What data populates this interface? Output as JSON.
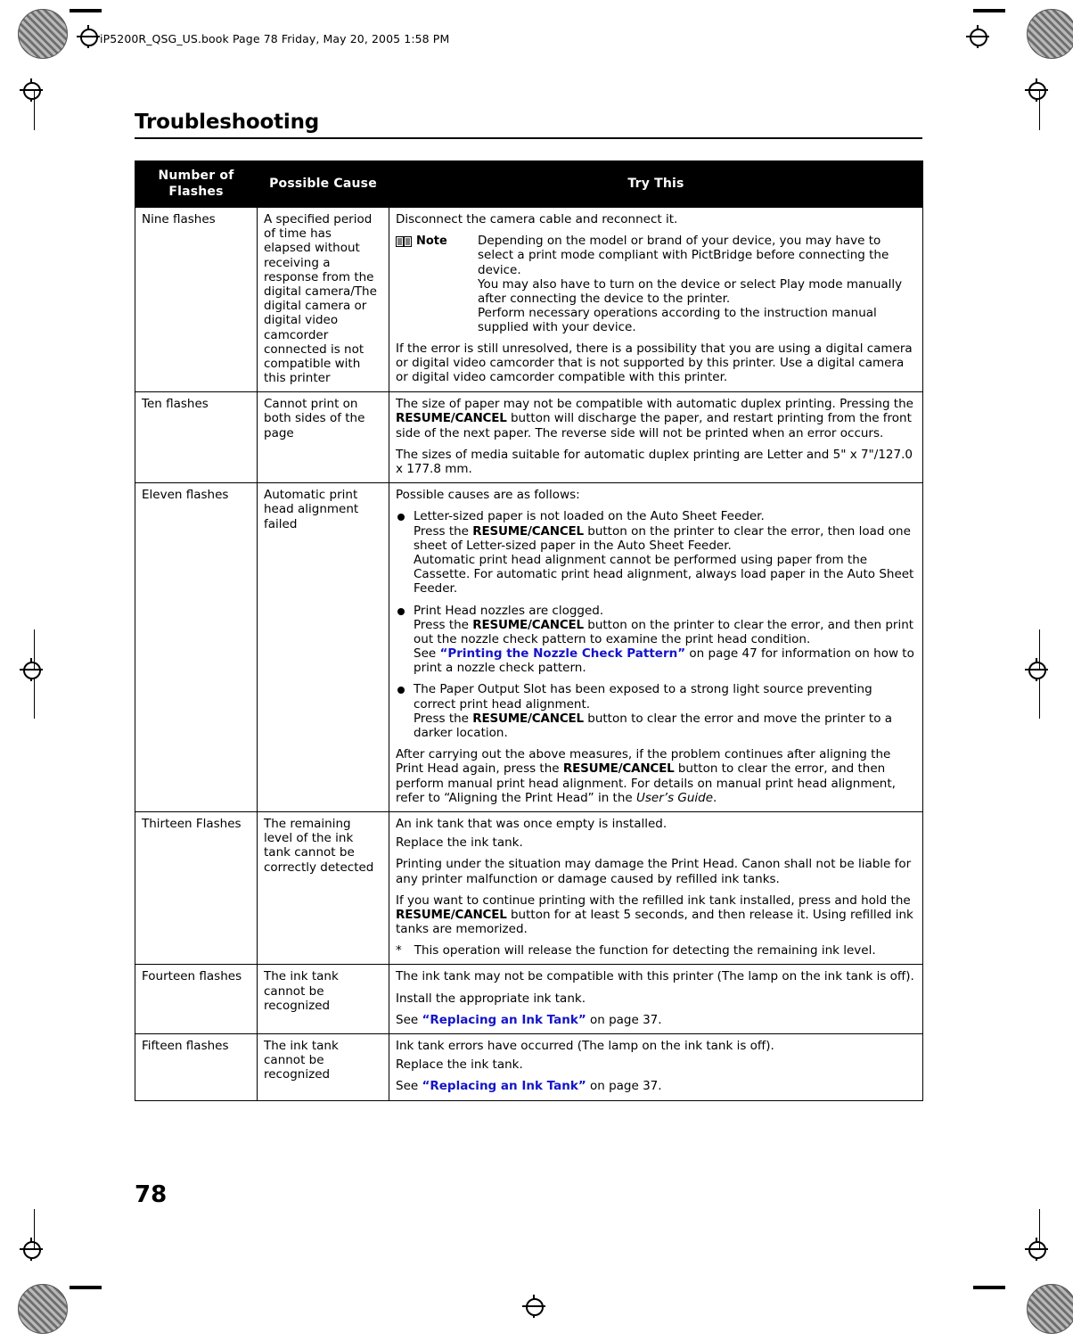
{
  "header": {
    "filestamp": "iP5200R_QSG_US.book  Page 78  Friday, May 20, 2005  1:58 PM",
    "section_title": "Troubleshooting",
    "page_number": "78"
  },
  "icons": {
    "note": "note-book-icon",
    "registration": "registration-mark-icon",
    "crosshair": "crosshair-registration-icon"
  },
  "colors": {
    "link": "#1414c8",
    "header_bg": "#000000",
    "header_fg": "#ffffff"
  },
  "table": {
    "columns": [
      "Number of Flashes",
      "Possible Cause",
      "Try This"
    ],
    "rows": [
      {
        "flashes": "Nine flashes",
        "cause": "A specified period of time has elapsed without receiving a response from the digital camera/The digital camera or digital video camcorder connected is not compatible with this printer",
        "try": {
          "intro": "Disconnect the camera cable and reconnect it.",
          "note_label": "Note",
          "note_lines": [
            "Depending on the model or brand of your device, you may have to select a print mode compliant with PictBridge before connecting the device.",
            "You may also have to turn on the device or select Play mode manually after connecting the device to the printer.",
            "Perform necessary operations according to the instruction manual supplied with your device."
          ],
          "outro": "If the error is still unresolved, there is a possibility that you are using a digital camera or digital video camcorder that is not supported by this printer. Use a digital camera or digital video camcorder compatible with this printer."
        }
      },
      {
        "flashes": "Ten flashes",
        "cause": "Cannot print on both sides of the page",
        "try": {
          "p1_a": "The size of paper may not be compatible with automatic duplex printing. Pressing the ",
          "p1_btn": "RESUME/CANCEL",
          "p1_b": " button will discharge the paper, and restart printing from the front side of the next paper. The reverse side will not be printed when an error occurs.",
          "p2": "The sizes of media suitable for automatic duplex printing are Letter and 5\" x 7\"/127.0 x 177.8 mm."
        }
      },
      {
        "flashes": "Eleven flashes",
        "cause": "Automatic print head alignment failed",
        "try": {
          "intro": "Possible causes are as follows:",
          "bullets": [
            {
              "l1": "Letter-sized paper is not loaded on the Auto Sheet Feeder.",
              "l2_a": "Press the ",
              "l2_btn": "RESUME/CANCEL",
              "l2_b": " button on the printer to clear the error, then load one sheet of Letter-sized paper in the Auto Sheet Feeder.",
              "l3": "Automatic print head alignment cannot be performed using paper from the Cassette. For automatic print head alignment, always load paper in the Auto Sheet Feeder."
            },
            {
              "l1": "Print Head nozzles are clogged.",
              "l2_a": "Press the ",
              "l2_btn": "RESUME/CANCEL",
              "l2_b": " button on the printer to clear the error, and then print out the nozzle check pattern to examine the print head condition.",
              "l3_a": "See ",
              "l3_link": "“Printing the Nozzle Check Pattern”",
              "l3_b": " on page 47 for information on how to print a nozzle check pattern."
            },
            {
              "l1": "The Paper Output Slot has been exposed to a strong light source preventing correct print head alignment.",
              "l2_a": "Press the ",
              "l2_btn": "RESUME/CANCEL",
              "l2_b": " button to clear the error and move the printer to a darker location."
            }
          ],
          "outro_a": "After carrying out the above measures, if the problem continues after aligning the Print Head again, press the ",
          "outro_btn": "RESUME/CANCEL",
          "outro_b": " button to clear the error, and then perform manual print head alignment. For details on manual print head alignment, refer to “Aligning the Print Head” in the ",
          "outro_ital": "User’s Guide",
          "outro_c": "."
        }
      },
      {
        "flashes": "Thirteen Flashes",
        "cause": "The remaining level of the ink tank cannot be correctly detected",
        "try": {
          "p1": "An ink tank that was once empty is installed.",
          "p2": "Replace the ink tank.",
          "p3": "Printing under the situation may damage the Print Head. Canon shall not be liable for any printer malfunction or damage caused by refilled ink tanks.",
          "p4_a": "If you want to continue printing with the refilled ink tank installed, press and hold the ",
          "p4_btn": "RESUME/CANCEL",
          "p4_b": " button for at least 5 seconds, and then release it. Using refilled ink tanks are memorized.",
          "star": "*",
          "p5": "This operation will release the function for detecting the remaining ink level."
        }
      },
      {
        "flashes": "Fourteen flashes",
        "cause": "The ink tank cannot be recognized",
        "try": {
          "p1": "The ink tank may not be compatible with this printer (The lamp on the ink tank is off).",
          "p2": "Install the appropriate ink tank.",
          "p3_a": "See ",
          "p3_link": "“Replacing an Ink Tank”",
          "p3_b": " on page 37."
        }
      },
      {
        "flashes": "Fifteen flashes",
        "cause": "The ink tank cannot be recognized",
        "try": {
          "p1": "Ink tank errors have occurred (The lamp on the ink tank is off).",
          "p2": "Replace the ink tank.",
          "p3_a": "See ",
          "p3_link": "“Replacing an Ink Tank”",
          "p3_b": " on page 37."
        }
      }
    ]
  }
}
